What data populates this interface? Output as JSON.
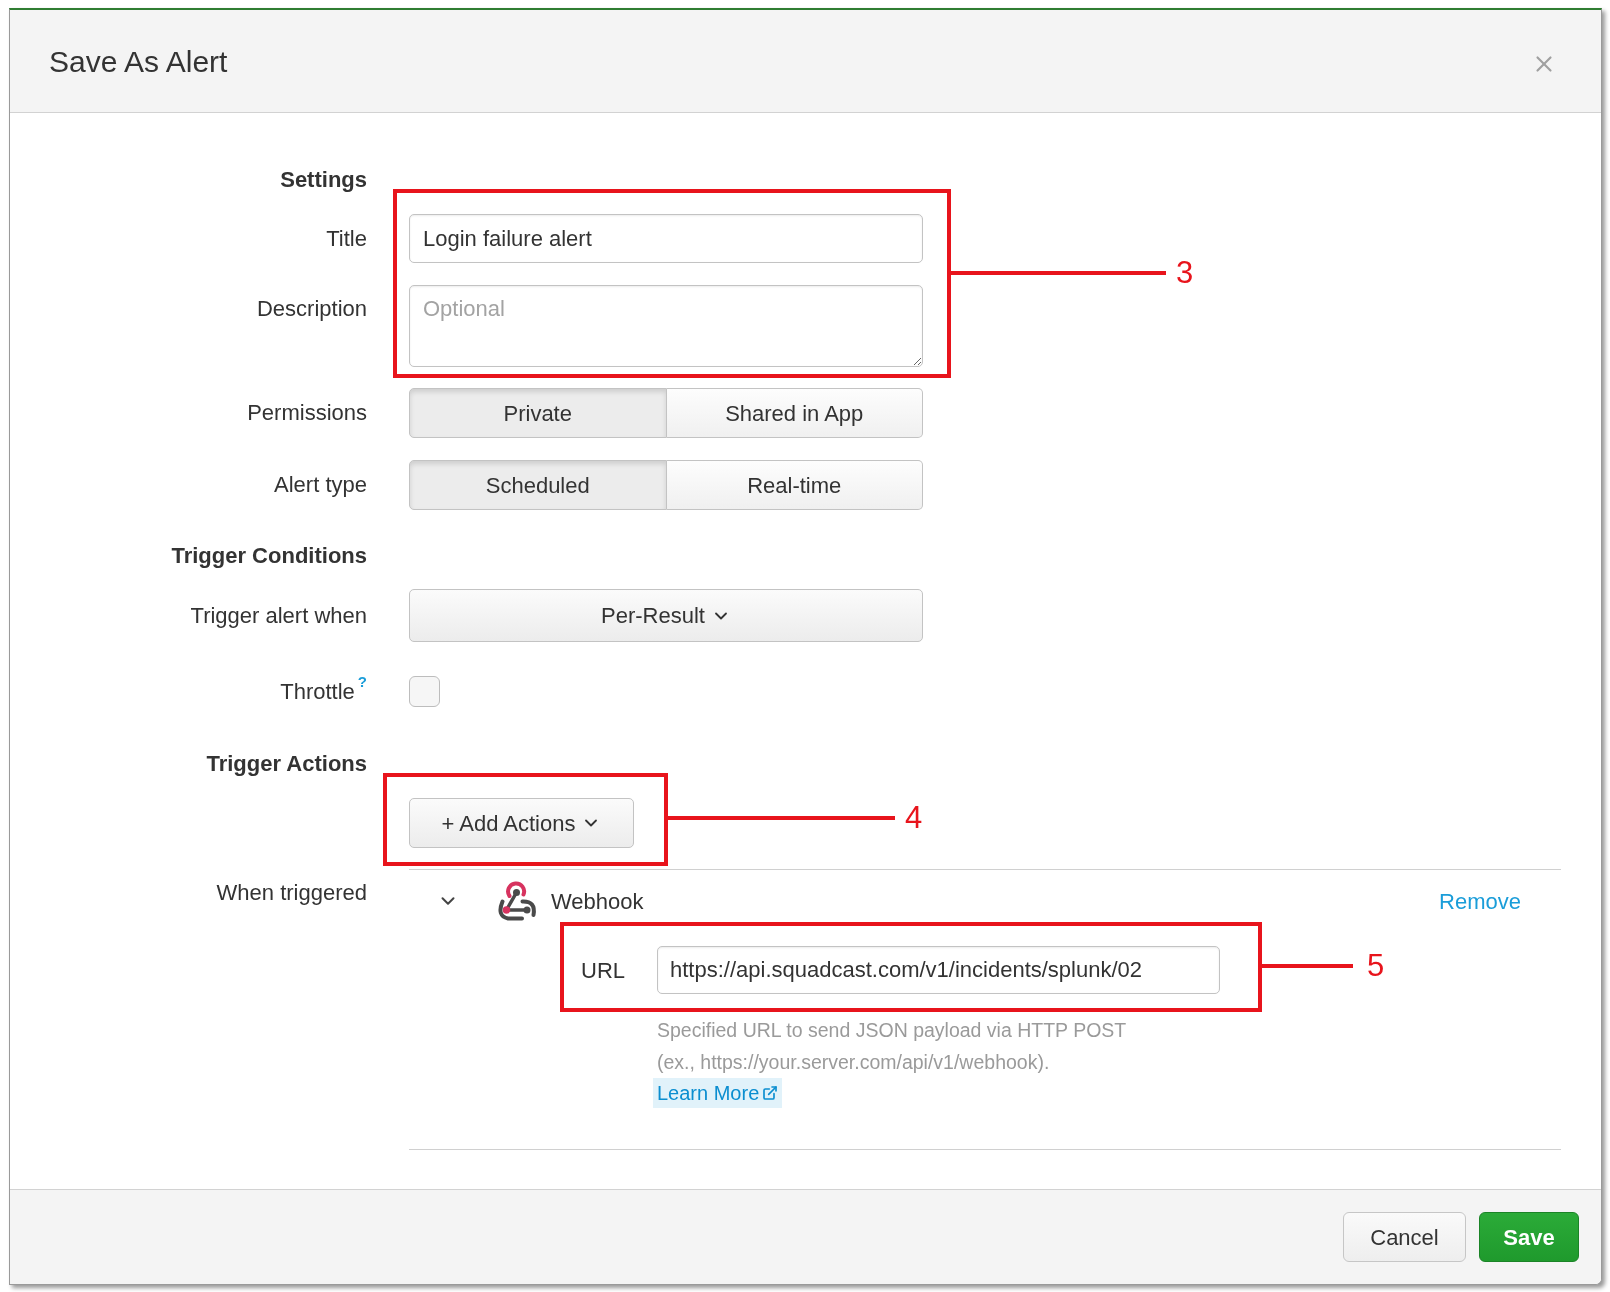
{
  "dialog": {
    "title": "Save As Alert"
  },
  "settings": {
    "heading": "Settings",
    "title": {
      "label": "Title",
      "value": "Login failure alert"
    },
    "description": {
      "label": "Description",
      "placeholder": "Optional"
    },
    "permissions": {
      "label": "Permissions",
      "options": [
        {
          "label": "Private",
          "selected": true
        },
        {
          "label": "Shared in App",
          "selected": false
        }
      ]
    },
    "alert_type": {
      "label": "Alert type",
      "options": [
        {
          "label": "Scheduled",
          "selected": true
        },
        {
          "label": "Real-time",
          "selected": false
        }
      ]
    }
  },
  "trigger_conditions": {
    "heading": "Trigger Conditions",
    "trigger_alert_when": {
      "label": "Trigger alert when",
      "value": "Per-Result"
    },
    "throttle": {
      "label": "Throttle",
      "help": "?",
      "checked": false
    }
  },
  "trigger_actions": {
    "heading": "Trigger Actions",
    "add_button": "+ Add Actions",
    "when_triggered": {
      "label": "When triggered",
      "actions": [
        {
          "name": "Webhook",
          "expanded": true,
          "remove": "Remove",
          "url": {
            "label": "URL",
            "value": "https://api.squadcast.com/v1/incidents/splunk/02"
          },
          "help": "Specified URL to send JSON payload via HTTP POST (ex., https://your.server.com/api/v1/webhook).",
          "learn_more": "Learn More"
        }
      ]
    }
  },
  "footer": {
    "buttons": [
      {
        "label": "Cancel",
        "kind": "secondary"
      },
      {
        "label": "Save",
        "kind": "primary"
      }
    ]
  },
  "annotations": [
    {
      "label": "3"
    },
    {
      "label": "4"
    },
    {
      "label": "5"
    }
  ]
}
